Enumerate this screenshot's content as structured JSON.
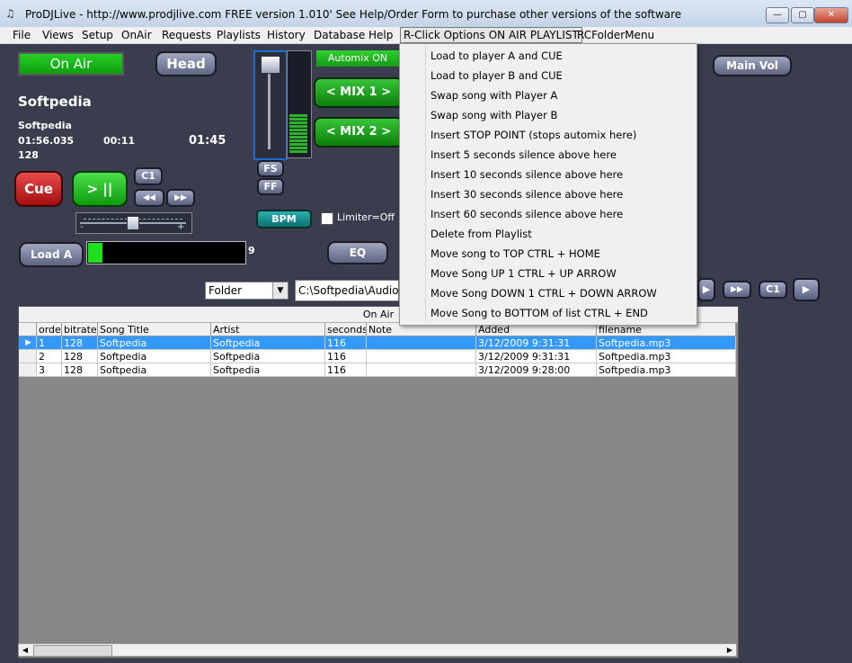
{
  "window": {
    "title": "ProDJLive - http://www.prodjlive.com FREE version 1.010' See Help/Order Form to purchase other versions of the software",
    "minimize": "—",
    "maximize": "▢",
    "close": "✕"
  },
  "menubar": {
    "items": [
      "File",
      "Views",
      "Setup",
      "OnAir",
      "Requests",
      "Playlists",
      "History",
      "Database",
      "Help",
      "R-Click Options ON AIR PLAYLIST",
      "RCFolderMenu"
    ]
  },
  "player_a": {
    "on_air_label": "On Air",
    "head_label": "Head",
    "song_big": "Softpedia",
    "song_small": "Softpedia",
    "time_elapsed": "01:56.035",
    "time_mid": "00:11",
    "time_remaining": "01:45",
    "bitrate": "128",
    "cue_label": "Cue",
    "play_pause_label": "> ||",
    "c1_label": "C1",
    "rewind_label": "◀◀",
    "forward_label": "▶▶",
    "load_label": "Load A",
    "load_count": "9",
    "pitch_minus": "-",
    "pitch_plus": "+"
  },
  "center": {
    "fs_label": "FS",
    "ff_label": "FF",
    "bpm_label": "BPM",
    "limiter_label": "Limiter=Off",
    "eq_label": "EQ",
    "automix_label": "Automix ON",
    "mix1_label": "< MIX 1 >",
    "mix2_label": "< MIX 2 >",
    "main_vol_label": "Main Vol"
  },
  "folder_bar": {
    "folder_select": "Folder",
    "path": "C:\\Softpedia\\Audio",
    "c1_label": "C1"
  },
  "context_menu": {
    "items": [
      "Load to player A and CUE",
      "Load to player B and CUE",
      "Swap song with Player A",
      "Swap song with Player B",
      "Insert STOP POINT (stops automix here)",
      "Insert 5 seconds silence above here",
      "Insert 10 seconds silence above here",
      "Insert 30 seconds silence above here",
      "Insert 60 seconds silence above here",
      "Delete from Playlist",
      "Move song to TOP  CTRL + HOME",
      "Move Song UP 1   CTRL + UP ARROW",
      "Move Song DOWN 1   CTRL + DOWN ARROW",
      "Move Song to BOTTOM of list  CTRL + END"
    ]
  },
  "playlist": {
    "band_title": "On Air",
    "columns": [
      "orde",
      "bitrate",
      "Song Title",
      "Artist",
      "seconds",
      "Note",
      "Added",
      "filename"
    ],
    "rows": [
      [
        "1",
        "128",
        "Softpedia",
        "Softpedia",
        "116",
        "",
        "3/12/2009 9:31:31",
        "Softpedia.mp3"
      ],
      [
        "2",
        "128",
        "Softpedia",
        "Softpedia",
        "116",
        "",
        "3/12/2009 9:31:31",
        "Softpedia.mp3"
      ],
      [
        "3",
        "128",
        "Softpedia",
        "Softpedia",
        "116",
        "",
        "3/12/2009 9:28:00",
        "Softpedia.mp3"
      ]
    ],
    "row_marker": "▶"
  },
  "colors": {
    "background": "#3a3d4e",
    "on_air_green": "#1fbe1f",
    "cue_red": "#c21a1a",
    "selection_blue": "#3399ff"
  }
}
